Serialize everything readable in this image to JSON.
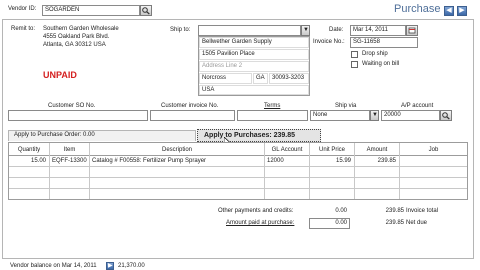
{
  "header": {
    "vendor_id_label": "Vendor ID:",
    "vendor_id_value": "SOGARDEN",
    "form_title": "Purchase"
  },
  "remit": {
    "label": "Remit to:",
    "lines": [
      "Southern Garden Wholesale",
      "4555 Oakland Park Blvd.",
      "Atlanta, GA 30312 USA"
    ]
  },
  "status": {
    "text": "UNPAID",
    "color": "#d42020"
  },
  "ship_to": {
    "label": "Ship to:",
    "name": "Bellwether Garden Supply",
    "address1": "1505 Pavilion Place",
    "address2_placeholder": "Address Line 2",
    "city": "Norcross",
    "state": "GA",
    "zip": "30093-3203",
    "country": "USA"
  },
  "date": {
    "label": "Date:",
    "value": "Mar 14, 2011"
  },
  "invoice_no": {
    "label": "Invoice No.:",
    "value": "SG-11658"
  },
  "drop_ship": {
    "label": "Drop ship"
  },
  "waiting_on_bill": {
    "label": "Waiting on bill"
  },
  "meta": {
    "customer_so_label": "Customer SO No.",
    "customer_invoice_label": "Customer invoice No.",
    "terms_label": "Terms",
    "ship_via_label": "Ship via",
    "ship_via_value": "None",
    "ap_account_label": "A/P account",
    "ap_account_value": "20000"
  },
  "tabs": {
    "apply_po": "Apply to Purchase Order: 0.00",
    "apply_purchases": "Apply to Purchases: 239.85"
  },
  "table": {
    "columns": [
      "Quantity",
      "Item",
      "Description",
      "GL Account",
      "Unit Price",
      "Amount",
      "Job"
    ],
    "rows": [
      {
        "quantity": "15.00",
        "item": "EQFF-13300",
        "description": "Catalog # F00558: Fertilizer Pump Sprayer",
        "gl_account": "12000",
        "unit_price": "15.99",
        "amount": "239.85",
        "job": ""
      }
    ]
  },
  "totals": {
    "other_payments_label": "Other payments and credits:",
    "other_payments_value": "0.00",
    "invoice_total_value": "239.85",
    "invoice_total_label": "Invoice total",
    "amount_paid_label": "Amount paid at purchase:",
    "amount_paid_value": "0.00",
    "net_due_value": "239.85",
    "net_due_label": "Net due"
  },
  "footer": {
    "vendor_balance_label": "Vendor balance on Mar 14, 2011",
    "vendor_balance_value": "21,370.00"
  },
  "colors": {
    "title": "#4f6f99",
    "accent_blue": "#3c68a8",
    "unpaid_red": "#d42020"
  }
}
